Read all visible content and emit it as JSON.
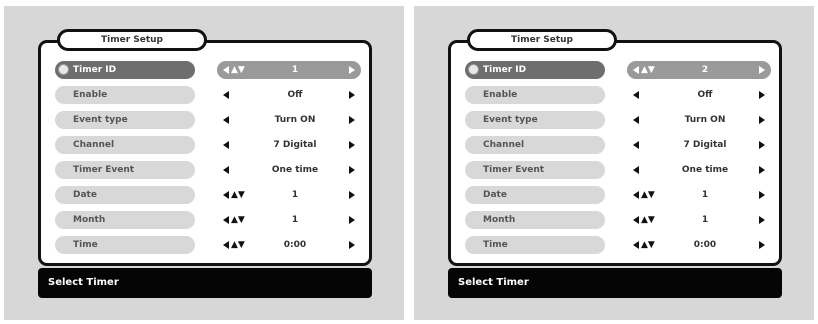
{
  "screens": [
    {
      "title": "Timer Setup",
      "rows": [
        {
          "label": "Timer ID",
          "value": "1",
          "updown": "▲▼"
        },
        {
          "label": "Enable",
          "value": "Off",
          "updown": ""
        },
        {
          "label": "Event type",
          "value": "Turn ON",
          "updown": ""
        },
        {
          "label": "Channel",
          "value": "7 Digital",
          "updown": ""
        },
        {
          "label": "Timer Event",
          "value": "One time",
          "updown": ""
        },
        {
          "label": "Date",
          "value": "1",
          "updown": "▲▼"
        },
        {
          "label": "Month",
          "value": "1",
          "updown": "▲▼"
        },
        {
          "label": "Time",
          "value": "0:00",
          "updown": "▲▼"
        }
      ],
      "status": "Select Timer"
    },
    {
      "title": "Timer Setup",
      "rows": [
        {
          "label": "Timer ID",
          "value": "2",
          "updown": "▲▼"
        },
        {
          "label": "Enable",
          "value": "Off",
          "updown": ""
        },
        {
          "label": "Event type",
          "value": "Turn ON",
          "updown": ""
        },
        {
          "label": "Channel",
          "value": "7 Digital",
          "updown": ""
        },
        {
          "label": "Timer Event",
          "value": "One time",
          "updown": ""
        },
        {
          "label": "Date",
          "value": "1",
          "updown": "▲▼"
        },
        {
          "label": "Month",
          "value": "1",
          "updown": "▲▼"
        },
        {
          "label": "Time",
          "value": "0:00",
          "updown": "▲▼"
        }
      ],
      "status": "Select Timer"
    }
  ]
}
